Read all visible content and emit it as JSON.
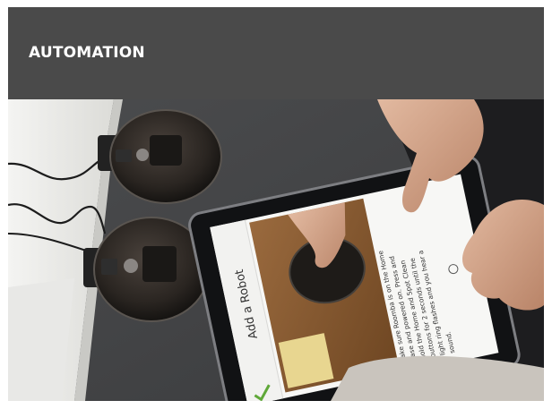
{
  "header": {
    "title": "AUTOMATION"
  },
  "tablet": {
    "screen_title": "Add a Robot",
    "instruction_text": "Make sure Roomba is on the Home Base and powered on. Press and hold the Home and Spot Clean buttons for 2 seconds until the light ring flashes and you hear a sound."
  },
  "colors": {
    "header_bg": "#4a4a4a",
    "title_text": "#ffffff",
    "app_accent": "#5fa838"
  }
}
